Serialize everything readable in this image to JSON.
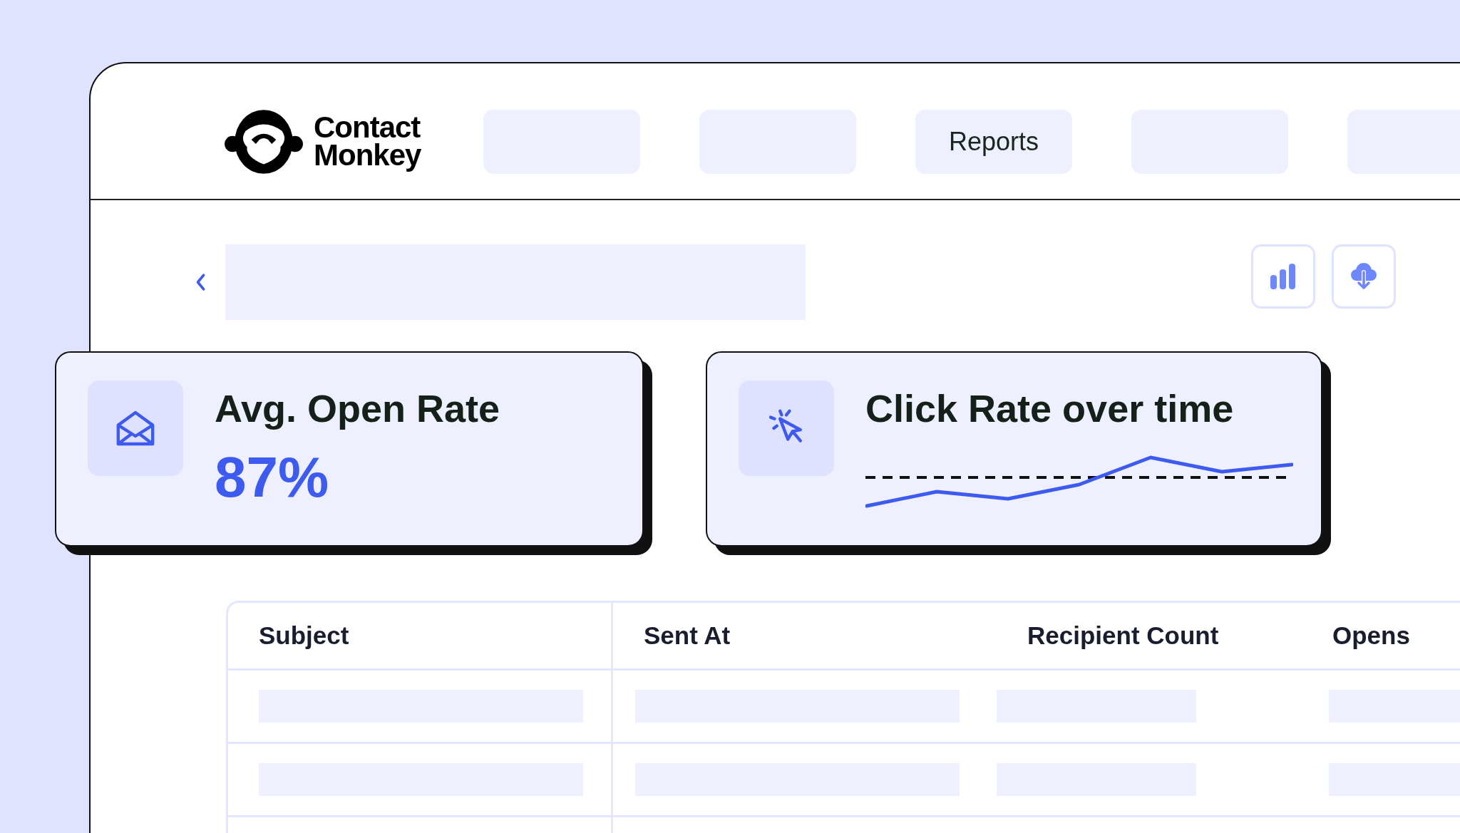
{
  "brand": {
    "name": "Contact Monkey"
  },
  "nav_items": [
    {
      "kind": "placeholder"
    },
    {
      "kind": "placeholder"
    },
    {
      "kind": "link",
      "label": "Reports"
    },
    {
      "kind": "placeholder"
    },
    {
      "kind": "placeholder"
    }
  ],
  "toolbar": {
    "actions": [
      {
        "kind": "chart"
      },
      {
        "kind": "download"
      }
    ]
  },
  "cards": [
    {
      "kind": "metric",
      "title": "Avg. Open Rate",
      "value": "87%"
    },
    {
      "kind": "trend",
      "title": "Click Rate over time"
    }
  ],
  "table": {
    "columns": [
      "Subject",
      "Sent At",
      "Recipient Count",
      "Opens"
    ],
    "rows": [
      {
        "kind": "skeleton"
      },
      {
        "kind": "skeleton"
      },
      {
        "kind": "cut"
      }
    ]
  }
}
